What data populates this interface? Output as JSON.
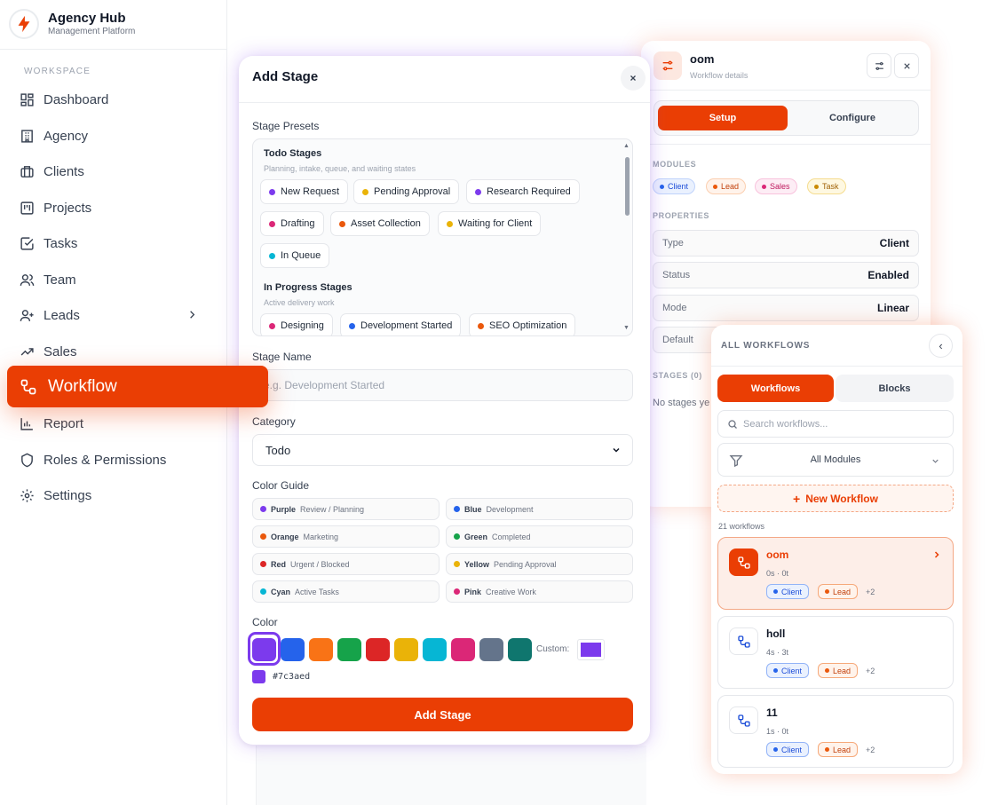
{
  "brand": {
    "name": "Agency Hub",
    "subtitle": "Management Platform"
  },
  "sidebar": {
    "section_label": "WORKSPACE",
    "items": [
      {
        "label": "Dashboard",
        "icon": "dashboard-icon"
      },
      {
        "label": "Agency",
        "icon": "building-icon"
      },
      {
        "label": "Clients",
        "icon": "briefcase-icon"
      },
      {
        "label": "Projects",
        "icon": "kanban-icon"
      },
      {
        "label": "Tasks",
        "icon": "checkbox-icon"
      },
      {
        "label": "Team",
        "icon": "users-icon"
      },
      {
        "label": "Leads",
        "icon": "user-plus-icon"
      },
      {
        "label": "Sales",
        "icon": "trending-up-icon"
      },
      {
        "label": "Workflow",
        "icon": "workflow-icon",
        "active": true
      },
      {
        "label": "Report",
        "icon": "bar-chart-icon"
      },
      {
        "label": "Roles & Permissions",
        "icon": "shield-icon"
      },
      {
        "label": "Settings",
        "icon": "gear-icon"
      }
    ]
  },
  "details": {
    "title": "oom",
    "subtitle": "Workflow details",
    "tabs": {
      "setup": "Setup",
      "configure": "Configure"
    },
    "modules_label": "MODULES",
    "modules": [
      {
        "label": "Client",
        "color": "#2563eb"
      },
      {
        "label": "Lead",
        "color": "#ea580c"
      },
      {
        "label": "Sales",
        "color": "#db2777"
      },
      {
        "label": "Task",
        "color": "#ca8a04"
      }
    ],
    "properties_label": "PROPERTIES",
    "properties": [
      {
        "key": "Type",
        "value": "Client"
      },
      {
        "key": "Status",
        "value": "Enabled"
      },
      {
        "key": "Mode",
        "value": "Linear"
      },
      {
        "key": "Default",
        "value": ""
      }
    ],
    "stages_label": "STAGES (0)",
    "stages_empty": "No stages ye"
  },
  "modal": {
    "title": "Add Stage",
    "close": "×",
    "presets_label": "Stage Presets",
    "preset_groups": [
      {
        "title": "Todo Stages",
        "subtitle": "Planning, intake, queue, and waiting states",
        "chips": [
          {
            "label": "New Request",
            "color": "#7c3aed"
          },
          {
            "label": "Pending Approval",
            "color": "#eab308"
          },
          {
            "label": "Research Required",
            "color": "#7c3aed"
          },
          {
            "label": "Drafting",
            "color": "#db2777"
          },
          {
            "label": "Asset Collection",
            "color": "#ea580c"
          },
          {
            "label": "Waiting for Client",
            "color": "#eab308"
          },
          {
            "label": "In Queue",
            "color": "#06b6d4"
          }
        ]
      },
      {
        "title": "In Progress Stages",
        "subtitle": "Active delivery work",
        "chips": [
          {
            "label": "Designing",
            "color": "#db2777"
          },
          {
            "label": "Development Started",
            "color": "#2563eb"
          },
          {
            "label": "SEO Optimization",
            "color": "#ea580c"
          }
        ]
      }
    ],
    "stage_name_label": "Stage Name",
    "stage_name_placeholder": "e.g. Development Started",
    "category_label": "Category",
    "category_value": "Todo",
    "color_guide_label": "Color Guide",
    "color_guide": [
      {
        "name": "Purple",
        "desc": "Review / Planning",
        "color": "#7c3aed"
      },
      {
        "name": "Blue",
        "desc": "Development",
        "color": "#2563eb"
      },
      {
        "name": "Orange",
        "desc": "Marketing",
        "color": "#ea580c"
      },
      {
        "name": "Green",
        "desc": "Completed",
        "color": "#16a34a"
      },
      {
        "name": "Red",
        "desc": "Urgent / Blocked",
        "color": "#dc2626"
      },
      {
        "name": "Yellow",
        "desc": "Pending Approval",
        "color": "#eab308"
      },
      {
        "name": "Cyan",
        "desc": "Active Tasks",
        "color": "#06b6d4"
      },
      {
        "name": "Pink",
        "desc": "Creative Work",
        "color": "#db2777"
      }
    ],
    "color_label": "Color",
    "swatches": [
      "#7c3aed",
      "#2563eb",
      "#f97316",
      "#16a34a",
      "#dc2626",
      "#eab308",
      "#06b6d4",
      "#db2777",
      "#64748b",
      "#0f766e"
    ],
    "selected_swatch": 0,
    "custom_label": "Custom:",
    "hex_value": "#7c3aed",
    "submit_label": "Add Stage"
  },
  "workflows": {
    "header": "ALL WORKFLOWS",
    "back": "‹",
    "tabs": {
      "workflows": "Workflows",
      "blocks": "Blocks"
    },
    "search_placeholder": "Search workflows...",
    "filter_value": "All Modules",
    "new_label": "New Workflow",
    "count_text": "21 workflows",
    "items": [
      {
        "name": "oom",
        "meta": "0s · 0t",
        "tags": [
          "Client",
          "Lead"
        ],
        "more": "+2",
        "active": true
      },
      {
        "name": "holl",
        "meta": "4s · 3t",
        "tags": [
          "Client",
          "Lead"
        ],
        "more": "+2",
        "active": false
      },
      {
        "name": "11",
        "meta": "1s · 0t",
        "tags": [
          "Client",
          "Lead"
        ],
        "more": "+2",
        "active": false
      }
    ],
    "tag_colors": {
      "Client": "#2563eb",
      "Lead": "#ea580c"
    }
  },
  "colors": {
    "accent": "#ea3e04",
    "modal_glow": "#7c3aed"
  }
}
